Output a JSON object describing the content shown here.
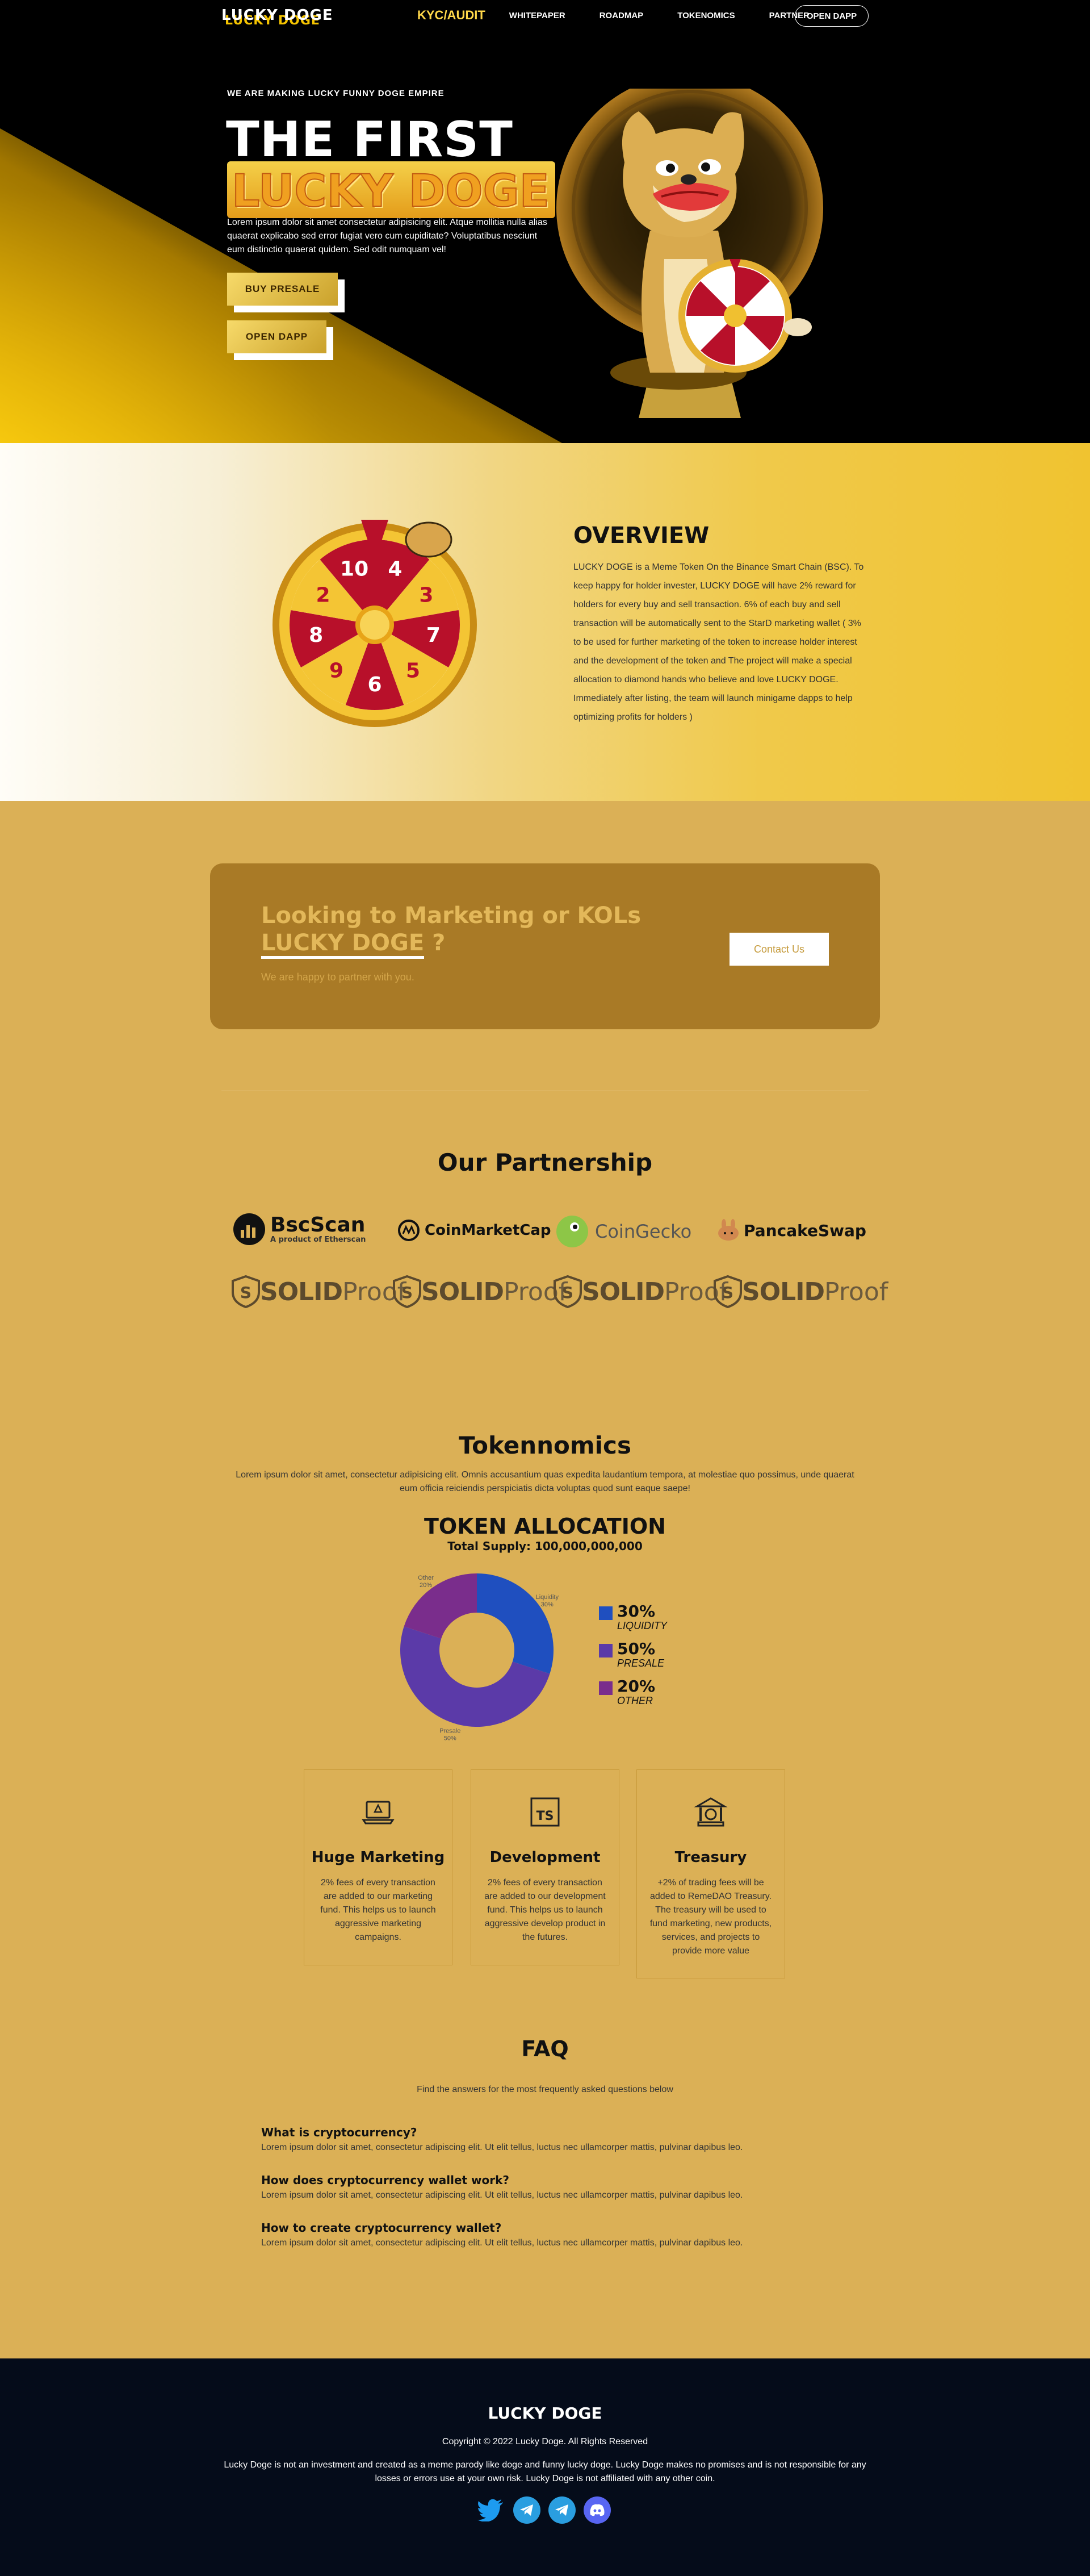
{
  "nav": {
    "logo": "LUCKY DOGE",
    "links": [
      "KYC/AUDIT",
      "WHITEPAPER",
      "ROADMAP",
      "TOKENOMICS",
      "PARTNER"
    ],
    "cta": "OPEN DAPP"
  },
  "hero": {
    "kicker": "WE ARE MAKING LUCKY FUNNY DOGE EMPIRE",
    "title": "THE FIRST",
    "subtitle": "LUCKY DOGE",
    "text": "Lorem ipsum dolor sit amet consectetur adipisicing elit. Atque mollitia nulla alias quaerat explicabo sed error fugiat vero cum cupiditate? Voluptatibus nesciunt eum distinctio quaerat quidem. Sed odit numquam vel!",
    "buttons": [
      "BUY PRESALE",
      "OPEN DAPP"
    ]
  },
  "overview": {
    "title": "OVERVIEW",
    "text": "LUCKY DOGE is a Meme Token On the Binance Smart Chain (BSC). To keep happy for holder invester, LUCKY DOGE will have 2% reward for holders for every buy and sell transaction. 6% of each buy and sell transaction will be automatically sent to the StarD marketing wallet ( 3% to be used for further marketing of the token to increase holder interest and the development of the token and The project will make a special allocation to diamond hands who believe and love LUCKY DOGE. Immediately after listing, the team will launch minigame dapps to help optimizing profits for holders )",
    "wheel_numbers": [
      "4",
      "3",
      "7",
      "5",
      "6",
      "9",
      "8",
      "2",
      "10"
    ]
  },
  "marketing": {
    "title_line1": "Looking to Marketing or KOLs",
    "title_line2_u": "LUCKY DOGE",
    "title_line2_rest": " ?",
    "subtitle": "We are happy to partner with you.",
    "button": "Contact Us"
  },
  "partnership": {
    "title": "Our Partnership",
    "bscscan": "BscScan",
    "bscscan_sub": "A product of Etherscan",
    "coinmarketcap": "CoinMarketCap",
    "coingecko": "CoinGecko",
    "pancakeswap": "PancakeSwap",
    "solid_bold": "SOLID",
    "solid_light": "Proof"
  },
  "tokenomics": {
    "title": "Tokennomics",
    "text": "Lorem ipsum dolor sit amet, consectetur adipisicing elit. Omnis accusantium quas expedita laudantium tempora, at molestiae quo possimus, unde quaerat eum officia reiciendis perspiciatis dicta voluptas quod sunt eaque saepe!",
    "allocation_title": "TOKEN ALLOCATION",
    "allocation_sub": "Total Supply: 100,000,000,000"
  },
  "chart_data": {
    "type": "pie",
    "title": "TOKEN ALLOCATION",
    "subtitle": "Total Supply: 100,000,000,000",
    "slices": [
      {
        "label": "LIQUIDITY",
        "value": 30,
        "color": "#1f4fbf",
        "pie_label": "Liquidity",
        "pie_pct": "30%"
      },
      {
        "label": "PRESALE",
        "value": 50,
        "color": "#5b3aa8",
        "pie_label": "Presale",
        "pie_pct": "50%"
      },
      {
        "label": "OTHER",
        "value": 20,
        "color": "#7a2d8c",
        "pie_label": "Other",
        "pie_pct": "20%"
      }
    ],
    "legend_position": "right"
  },
  "features": [
    {
      "icon": "laptop-icon",
      "title": "Huge Marketing",
      "text": "2% fees of every transaction are added to our marketing fund. This helps us to launch aggressive marketing campaigns."
    },
    {
      "icon": "typescript-icon",
      "title": "Development",
      "text": "2% fees of every transaction are added to our development fund. This helps us to launch aggressive develop product in the futures."
    },
    {
      "icon": "bank-icon",
      "title": "Treasury",
      "text": "+2% of trading fees will be added to RemeDAO Treasury. The treasury will be used to fund marketing, new products, services, and projects to provide more value"
    }
  ],
  "faq": {
    "title": "FAQ",
    "subtitle": "Find the answers for the most frequently asked questions below",
    "items": [
      {
        "q": "What is cryptocurrency?",
        "a": "Lorem ipsum dolor sit amet, consectetur adipiscing elit. Ut elit tellus, luctus nec ullamcorper mattis, pulvinar dapibus leo."
      },
      {
        "q": "How does cryptocurrency wallet work?",
        "a": "Lorem ipsum dolor sit amet, consectetur adipiscing elit. Ut elit tellus, luctus nec ullamcorper mattis, pulvinar dapibus leo."
      },
      {
        "q": "How to create cryptocurrency wallet?",
        "a": "Lorem ipsum dolor sit amet, consectetur adipiscing elit. Ut elit tellus, luctus nec ullamcorper mattis, pulvinar dapibus leo."
      }
    ]
  },
  "footer": {
    "logo": "LUCKY DOGE",
    "copyright": "Copyright © 2022 Lucky Doge. All Rights Reserved",
    "disclaimer": "Lucky Doge is not an investment and created as a meme parody like doge and funny lucky doge. Lucky Doge makes no promises and is not responsible for any losses or errors use at your own risk. Lucky Doge is not affiliated with any other coin.",
    "socials": [
      "twitter-icon",
      "telegram-icon",
      "telegram-icon",
      "discord-icon"
    ]
  },
  "colors": {
    "gold": "#dbb056",
    "brand_yellow": "#f5c400",
    "card_brown": "#a97a26",
    "footer_navy": "#050c1a",
    "wheel_red": "#b8102a"
  }
}
